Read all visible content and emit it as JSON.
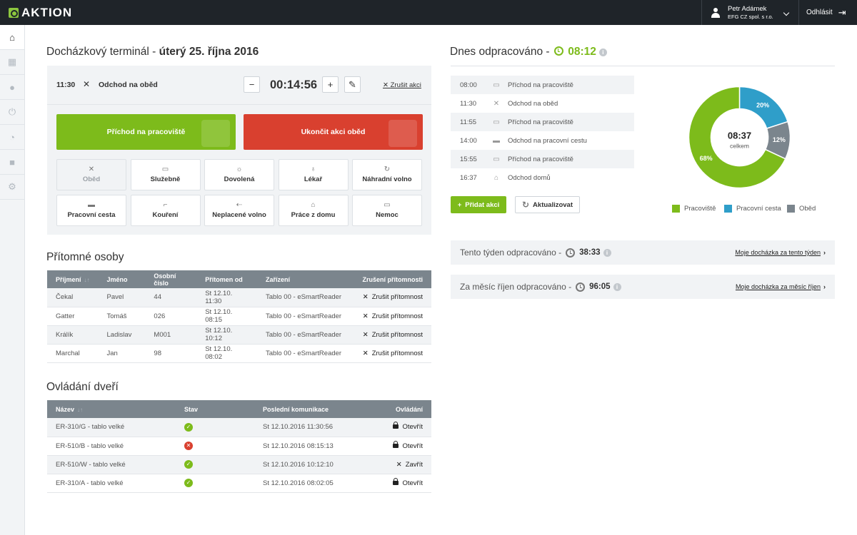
{
  "header": {
    "logo_text": "AKTION",
    "user_name": "Petr Adámek",
    "user_company": "EFG CZ spol. s r.o.",
    "logout_label": "Odhlásit"
  },
  "sidebar": {
    "items": [
      "home-icon",
      "calendar-icon",
      "user-icon",
      "power-icon",
      "clock-icon",
      "lock-icon",
      "gear-icon"
    ]
  },
  "terminal": {
    "title": "Docházkový terminál - ",
    "date": "úterý 25. října 2016",
    "current_action": {
      "time": "11:30",
      "icon": "cutlery-icon",
      "name": "Odchod na oběd",
      "timer": "00:14:56"
    },
    "minus_label": "−",
    "plus_label": "+",
    "cancel_label": "Zrušit akci",
    "primary_button": "Příchod na pracoviště",
    "stop_button": "Ukončit akci oběd",
    "tiles": [
      {
        "label": "Oběd",
        "icon": "✕",
        "disabled": true
      },
      {
        "label": "Služebně",
        "icon": "▭"
      },
      {
        "label": "Dovolená",
        "icon": "☼"
      },
      {
        "label": "Lékař",
        "icon": "♁"
      },
      {
        "label": "Náhradní volno",
        "icon": "↻"
      },
      {
        "label": "Pracovní cesta",
        "icon": "▬"
      },
      {
        "label": "Kouření",
        "icon": "⌐"
      },
      {
        "label": "Neplacené volno",
        "icon": "⇠"
      },
      {
        "label": "Práce z domu",
        "icon": "⌂"
      },
      {
        "label": "Nemoc",
        "icon": "▭"
      }
    ]
  },
  "present": {
    "title": "Přítomné osoby",
    "columns": [
      "Příjmení",
      "Jméno",
      "Osobní číslo",
      "Přítomen od",
      "Zařízení",
      "Zrušení přítomnosti"
    ],
    "rows": [
      [
        "Čekal",
        "Pavel",
        "44",
        "St 12.10.  11:30",
        "Tablo 00 - eSmartReader",
        "Zrušit přítomnost"
      ],
      [
        "Gatter",
        "Tomáš",
        "026",
        "St 12.10.  08:15",
        "Tablo 00 - eSmartReader",
        "Zrušit přítomnost"
      ],
      [
        "Králík",
        "Ladislav",
        "M001",
        "St 12.10.  10:12",
        "Tablo 00 - eSmartReader",
        "Zrušit přítomnost"
      ],
      [
        "Marchal",
        "Jan",
        "98",
        "St 12.10.  08:02",
        "Tablo 00 - eSmartReader",
        "Zrušit přítomnost"
      ]
    ]
  },
  "doors": {
    "title": "Ovládání dveří",
    "columns": [
      "Název",
      "Stav",
      "Poslední komunikace",
      "Ovládání"
    ],
    "rows": [
      {
        "name": "ER-310/G - tablo velké",
        "ok": true,
        "last": "St 12.10.2016  11:30:56",
        "action": "Otevřít",
        "locked": true
      },
      {
        "name": "ER-510/B - tablo velké",
        "ok": false,
        "last": "St 12.10.2016  08:15:13",
        "action": "Otevřít",
        "locked": true
      },
      {
        "name": "ER-510/W - tablo velké",
        "ok": true,
        "last": "St 12.10.2016  10:12:10",
        "action": "Zavřít",
        "locked": false
      },
      {
        "name": "ER-310/A - tablo velké",
        "ok": true,
        "last": "St 12.10.2016  08:02:05",
        "action": "Otevřít",
        "locked": true
      }
    ]
  },
  "today": {
    "title": "Dnes odpracováno - ",
    "value": "08:12",
    "info": "i",
    "events": [
      {
        "time": "08:00",
        "icon": "▭",
        "label": "Příchod na pracoviště"
      },
      {
        "time": "11:30",
        "icon": "✕",
        "label": "Odchod na oběd"
      },
      {
        "time": "11:55",
        "icon": "▭",
        "label": "Příchod na pracoviště"
      },
      {
        "time": "14:00",
        "icon": "▬",
        "label": "Odchod na pracovní cestu"
      },
      {
        "time": "15:55",
        "icon": "▭",
        "label": "Příchod na pracoviště"
      },
      {
        "time": "16:37",
        "icon": "⌂",
        "label": "Odchod domů"
      }
    ],
    "add_label": "Přidat akci",
    "refresh_label": "Aktualizovat",
    "donut_center_value": "08:37",
    "donut_center_label": "celkem",
    "colors": {
      "pracoviste": "#7dbb1b",
      "cesta": "#2f9ec9",
      "obed": "#7b858d"
    }
  },
  "chart_data": {
    "type": "pie",
    "categories": [
      "Pracoviště",
      "Pracovní cesta",
      "Oběd"
    ],
    "values": [
      68,
      20,
      12
    ],
    "labels": [
      "68%",
      "20%",
      "12%"
    ],
    "colors": [
      "#7dbb1b",
      "#2f9ec9",
      "#7b858d"
    ]
  },
  "summary": {
    "week_label": "Tento týden odpracováno - ",
    "week_value": "38:33",
    "week_link": "Moje docházka za tento týden",
    "month_label": "Za měsíc říjen odpracováno - ",
    "month_value": "96:05",
    "month_link": "Moje docházka za měsíc říjen"
  }
}
